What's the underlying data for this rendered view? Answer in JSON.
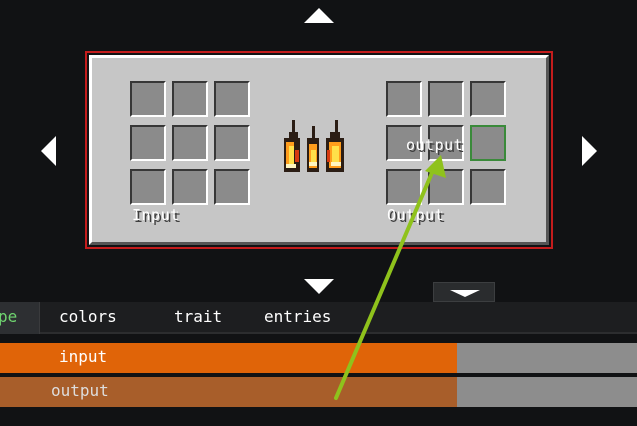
{
  "recipe": {
    "input_label": "Input",
    "output_label": "Output",
    "hover_tooltip": "output",
    "input_slot_count": 9,
    "output_slot_count": 9,
    "highlighted_output_slot": 5
  },
  "tabs": [
    {
      "label": "pe",
      "active": true
    },
    {
      "label": "colors",
      "active": false
    },
    {
      "label": "trait",
      "active": false
    },
    {
      "label": "entries",
      "active": false
    }
  ],
  "list": {
    "rows": [
      {
        "label": "input",
        "fill_fraction": 0.717,
        "color": "#e06408",
        "label_color": "#ffffff"
      },
      {
        "label": "output",
        "fill_fraction": 0.717,
        "color": "#a85e2a",
        "label_color": "#dddddd"
      }
    ]
  },
  "colors": {
    "selection_border": "#c41c1c",
    "slot_highlight": "#3a8a3a",
    "pointer_arrow": "#8fc21c",
    "active_tab_text": "#6fd46f"
  },
  "icons": {
    "up": "triangle-up",
    "down": "triangle-down",
    "left": "triangle-left",
    "right": "triangle-right",
    "dropdown": "triangle-down",
    "burner": "fire-pixel"
  }
}
